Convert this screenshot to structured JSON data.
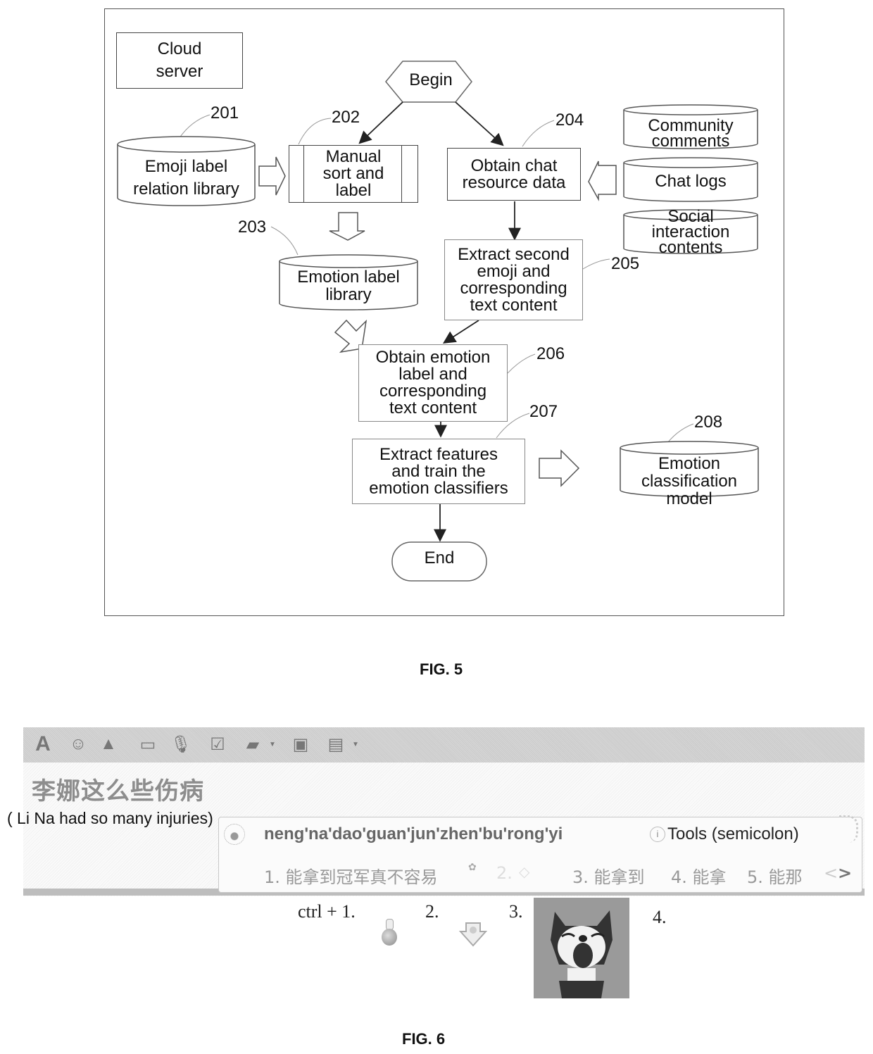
{
  "fig5": {
    "caption": "FIG. 5",
    "legend_box": {
      "line1": "Cloud",
      "line2": "server"
    },
    "begin": "Begin",
    "end": "End",
    "nodes": {
      "n201": {
        "ref": "201",
        "lines": [
          "Emoji label",
          "relation library"
        ],
        "shape": "database"
      },
      "n202": {
        "ref": "202",
        "lines": [
          "Manual",
          "sort and",
          "label"
        ],
        "shape": "predefined-process"
      },
      "n203": {
        "ref": "203",
        "lines": [
          "Emotion label",
          "library"
        ],
        "shape": "database"
      },
      "n204": {
        "ref": "204",
        "lines": [
          "Obtain chat",
          "resource data"
        ],
        "shape": "process"
      },
      "n205": {
        "ref": "205",
        "lines": [
          "Extract second",
          "emoji and",
          "corresponding",
          "text content"
        ],
        "shape": "process"
      },
      "n206": {
        "ref": "206",
        "lines": [
          "Obtain emotion",
          "label and",
          "corresponding",
          "text content"
        ],
        "shape": "process"
      },
      "n207": {
        "ref": "207",
        "lines": [
          "Extract features",
          "and train the",
          "emotion classifiers"
        ],
        "shape": "process"
      },
      "n208": {
        "ref": "208",
        "lines": [
          "Emotion",
          "classification",
          "model"
        ],
        "shape": "database"
      }
    },
    "sources": [
      {
        "lines": [
          "Community",
          "comments"
        ]
      },
      {
        "lines": [
          "Chat logs"
        ]
      },
      {
        "lines": [
          "Social",
          "interaction",
          "contents"
        ]
      }
    ]
  },
  "fig6": {
    "caption": "FIG. 6",
    "toolbar_icons": [
      "font-icon",
      "emoticon-icon",
      "shake-icon",
      "screenshot-icon",
      "voice-icon",
      "checklist-icon",
      "image-icon",
      "card-icon",
      "history-icon"
    ],
    "chat_text": "李娜这么些伤病",
    "chat_translation": "( Li Na had so many injuries)",
    "ime": {
      "pinyin": "neng'na'dao'guan'jun'zhen'bu'rong'yi",
      "tools_label": "Tools (semicolon)",
      "candidates": [
        {
          "label": "1. 能拿到冠军真不容易"
        },
        {
          "label": "2."
        },
        {
          "label": "3. 能拿到"
        },
        {
          "label": "4. 能拿"
        },
        {
          "label": "5. 能那"
        }
      ],
      "prev": "<",
      "next": ">"
    },
    "emoji_candidates": [
      {
        "label": "ctrl + 1.",
        "icon": "gourd-emoji-icon"
      },
      {
        "label": "2.",
        "icon": "trophy-emoji-icon"
      },
      {
        "label": "3.",
        "icon": "laughing-cat-sticker"
      },
      {
        "label": "4.",
        "icon": ""
      }
    ]
  }
}
